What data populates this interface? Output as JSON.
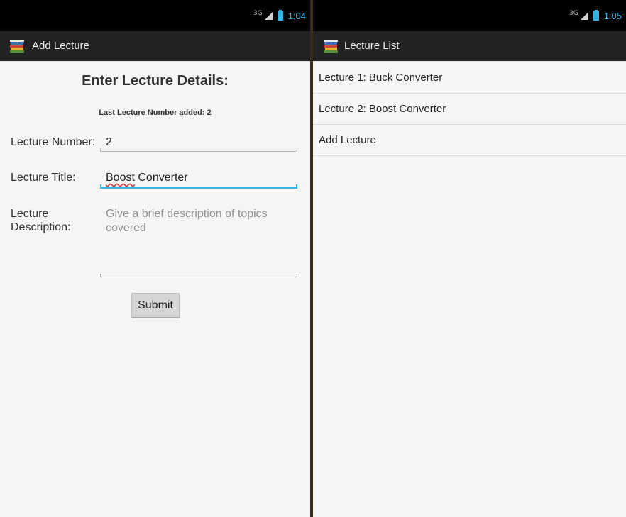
{
  "left_screen": {
    "status": {
      "network": "3G",
      "time": "1:04"
    },
    "action_bar": {
      "title": "Add Lecture",
      "icon": "books-app-icon"
    },
    "form": {
      "heading": "Enter Lecture Details:",
      "last_added_text": "Last Lecture Number added: 2",
      "lecture_number_label": "Lecture Number:",
      "lecture_number_value": "2",
      "lecture_title_label": "Lecture Title:",
      "lecture_title_word1": "Boost",
      "lecture_title_word2": " Converter",
      "lecture_description_label_line1": "Lecture",
      "lecture_description_label_line2": "Description:",
      "lecture_description_placeholder": "Give a brief description of topics covered",
      "submit_label": "Submit"
    }
  },
  "right_screen": {
    "status": {
      "network": "3G",
      "time": "1:05"
    },
    "action_bar": {
      "title": "Lecture List",
      "icon": "books-app-icon"
    },
    "list_items": [
      "Lecture 1: Buck Converter",
      "Lecture 2: Boost Converter",
      "Add Lecture"
    ]
  },
  "colors": {
    "accent": "#33b5e5",
    "action_bar_bg": "#222222",
    "status_bar_bg": "#000000",
    "background": "#f5f5f5"
  }
}
